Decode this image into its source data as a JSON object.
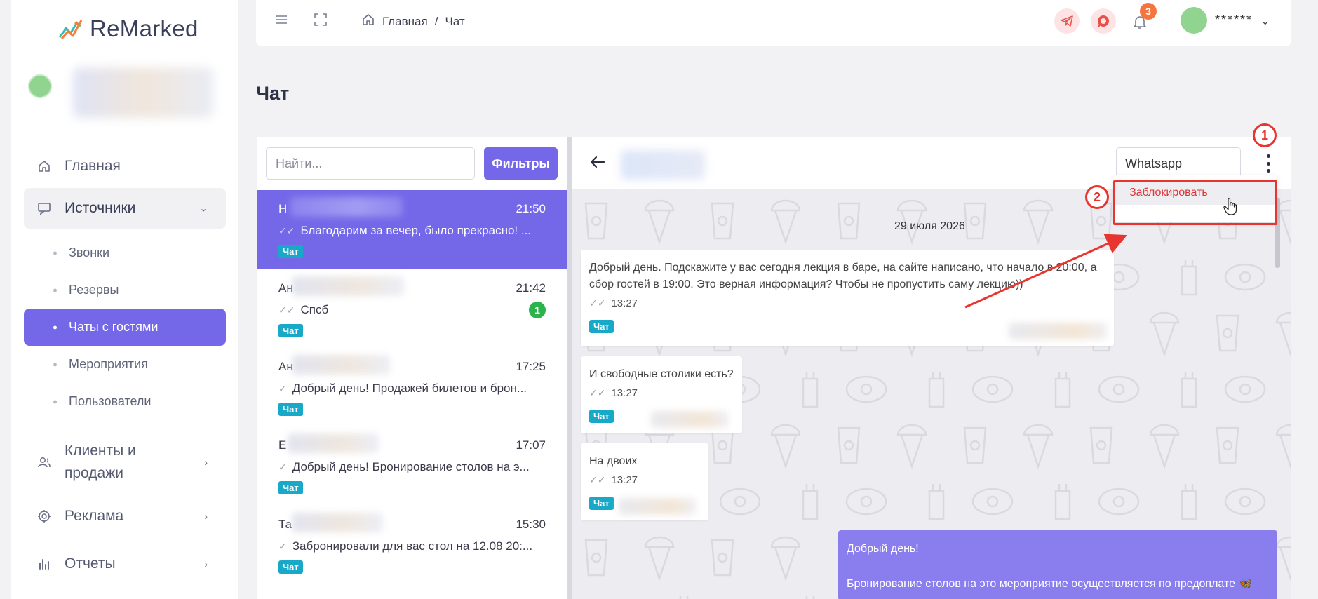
{
  "app": {
    "logo_text": "ReMarked"
  },
  "sidebar": {
    "items": [
      {
        "label": "Главная",
        "icon": "home-icon"
      },
      {
        "label": "Источники",
        "icon": "monitor-chat-icon"
      },
      {
        "label": "Клиенты и продажи",
        "icon": "users-icon"
      },
      {
        "label": "Реклама",
        "icon": "target-icon"
      },
      {
        "label": "Отчеты",
        "icon": "bar-chart-icon"
      }
    ],
    "sources_sub": [
      {
        "label": "Звонки"
      },
      {
        "label": "Резервы"
      },
      {
        "label": "Чаты с гостями"
      },
      {
        "label": "Мероприятия"
      },
      {
        "label": "Пользователи"
      }
    ],
    "active_sub": "Чаты с гостями",
    "accent_color": "#7468e8"
  },
  "header": {
    "breadcrumb": {
      "home": "Главная",
      "separator": "/",
      "current": "Чат"
    },
    "notifications_count": "3",
    "user_name": "******"
  },
  "page": {
    "title": "Чат"
  },
  "chat_list": {
    "search_placeholder": "Найти...",
    "filter_label": "Фильтры",
    "items": [
      {
        "name": "Н",
        "time": "21:50",
        "preview": "Благодарим за вечер, было прекрасно! ...",
        "tag": "Чат",
        "active": true,
        "unread": ""
      },
      {
        "name": "Ан",
        "time": "21:42",
        "preview": "Спсб",
        "tag": "Чат",
        "active": false,
        "unread": "1"
      },
      {
        "name": "Ан",
        "time": "17:25",
        "preview": "Добрый день! Продажей билетов и брон...",
        "tag": "Чат",
        "active": false,
        "unread": ""
      },
      {
        "name": "Е",
        "time": "17:07",
        "preview": "Добрый день! Бронирование столов на э...",
        "tag": "Чат",
        "active": false,
        "unread": ""
      },
      {
        "name": "Та",
        "time": "15:30",
        "preview": "Забронировали для вас стол на 12.08 20:...",
        "tag": "Чат",
        "active": false,
        "unread": ""
      }
    ]
  },
  "conversation": {
    "channel": "Whatsapp",
    "date": "29 июля 2026",
    "messages": [
      {
        "text": "Добрый день. Подскажите у вас сегодня лекция в баре, на сайте написано, что начало в 20:00, а сбор гостей в 19:00. Это верная информация? Чтобы не пропустить саму лекцию))",
        "time": "13:27",
        "tag": "Чат"
      },
      {
        "text": "И свободные столики есть?",
        "time": "13:27",
        "tag": "Чат"
      },
      {
        "text": "На двоих",
        "time": "13:27",
        "tag": "Чат"
      }
    ],
    "outgoing": {
      "line1": "Добрый день!",
      "line2": "Бронирование столов на это мероприятие осуществляется по предоплате 🦋"
    }
  },
  "menu": {
    "block_label": "Заблокировать"
  },
  "annotations": {
    "step1": "1",
    "step2": "2",
    "color": "#e8352f"
  }
}
